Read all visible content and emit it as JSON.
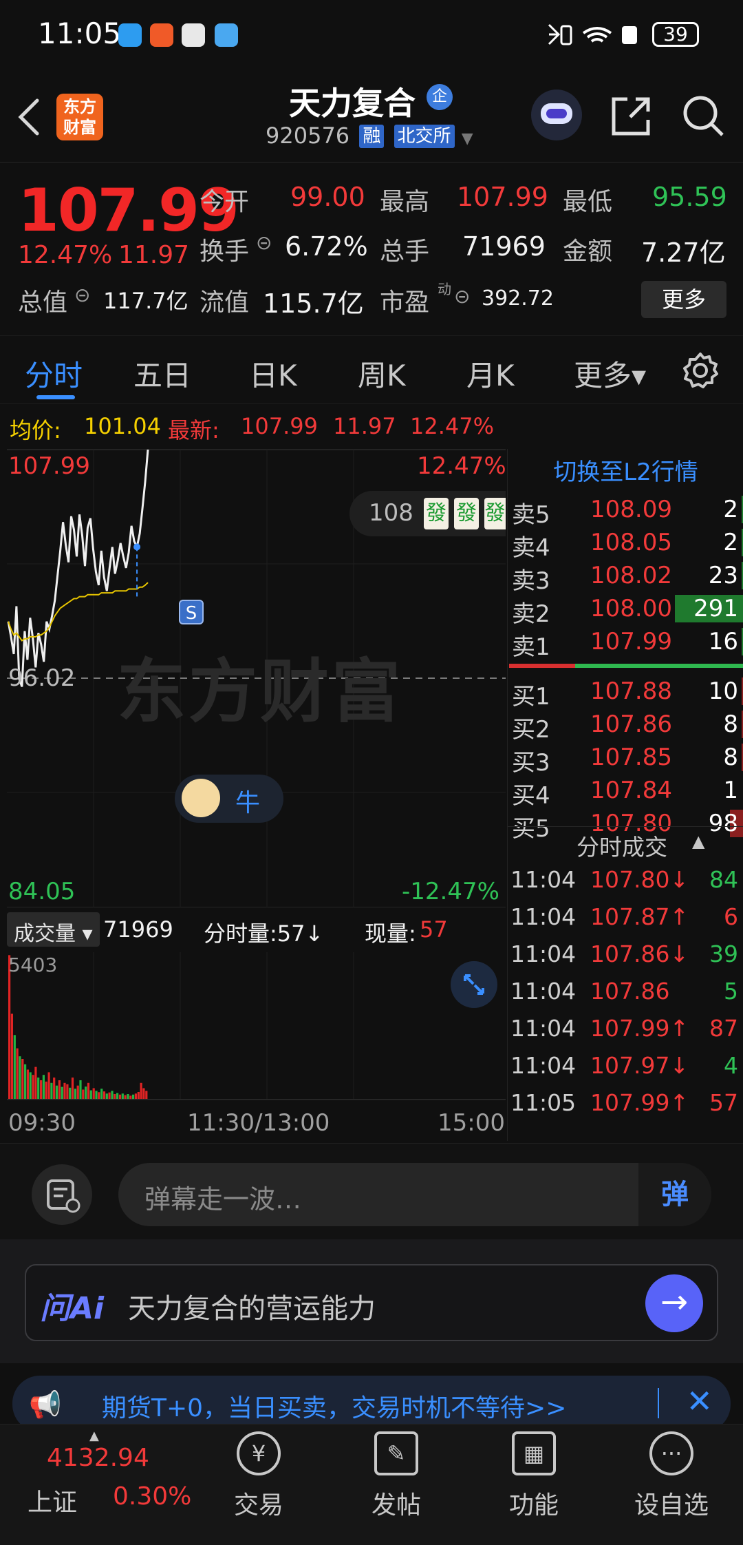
{
  "status_bar": {
    "time": "11:05",
    "battery": "39"
  },
  "header": {
    "logo_text": "东方财富",
    "stock_name": "天力复合",
    "corp_badge": "企",
    "stock_code": "920576",
    "tag_margin": "融",
    "tag_exchange": "北交所",
    "icons": [
      "back-icon",
      "robot-avatar-icon",
      "share-icon",
      "search-icon"
    ]
  },
  "quote": {
    "price": "107.99",
    "change_pct": "12.47%",
    "change_amt": "11.97",
    "open_label": "今开",
    "open": "99.00",
    "high_label": "最高",
    "high": "107.99",
    "low_label": "最低",
    "low": "95.59",
    "turnover_label": "换手",
    "turnover": "6.72%",
    "volume_label": "总手",
    "volume": "71969",
    "amount_label": "金额",
    "amount": "7.27亿",
    "mktcap_label": "总值",
    "mktcap": "117.7亿",
    "float_label": "流值",
    "float_cap": "115.7亿",
    "pe_label": "市盈",
    "pe_sup": "动",
    "pe": "392.72",
    "more_button": "更多"
  },
  "tabs": [
    {
      "label": "分时",
      "active": true
    },
    {
      "label": "五日"
    },
    {
      "label": "日K"
    },
    {
      "label": "周K"
    },
    {
      "label": "月K"
    },
    {
      "label": "更多▾"
    }
  ],
  "infoline": {
    "avg_label": "均价:",
    "avg": "101.04",
    "latest_label": "最新:",
    "latest": "107.99",
    "latest_chg": "11.97",
    "latest_pct": "12.47%"
  },
  "chart_labels": {
    "y_top": "107.99",
    "y_mid": "96.02",
    "y_bot": "84.05",
    "pct_top": "12.47%",
    "pct_bot": "-12.47%",
    "watermark": "东方财富",
    "bubble_price": "108",
    "bubble_tile": "發",
    "signal": "S",
    "niu": "牛"
  },
  "chart_data": {
    "type": "line",
    "title": "",
    "ylim": [
      84.05,
      107.99
    ],
    "series": [
      {
        "name": "",
        "values": [
          99.0,
          98.2,
          97.3,
          99.8,
          96.0,
          95.59,
          98.5,
          97.0,
          99.2,
          98.1,
          96.6,
          98.4,
          97.8,
          96.9,
          99.0,
          98.6,
          99.3,
          100.1,
          101.4,
          102.7,
          104.2,
          103.0,
          102.1,
          104.5,
          103.8,
          102.4,
          104.6,
          103.5,
          101.9,
          103.9,
          104.4,
          102.8,
          101.6,
          100.9,
          102.7,
          101.3,
          100.6,
          101.8,
          102.9,
          101.5,
          102.2,
          103.1,
          102.4,
          101.8,
          102.6,
          104.0,
          103.2,
          102.9,
          103.6,
          104.9,
          106.3,
          107.99
        ]
      },
      {
        "name": "",
        "values": [
          99.0,
          98.6,
          98.3,
          98.4,
          98.2,
          98.0,
          98.1,
          98.1,
          98.2,
          98.2,
          98.2,
          98.3,
          98.3,
          98.4,
          98.5,
          98.7,
          99.0,
          99.3,
          99.5,
          99.7,
          99.8,
          99.9,
          100.0,
          100.1,
          100.2,
          100.2,
          100.3,
          100.3,
          100.3,
          100.4,
          100.4,
          100.4,
          100.4,
          100.4,
          100.5,
          100.5,
          100.5,
          100.5,
          100.5,
          100.6,
          100.6,
          100.6,
          100.6,
          100.6,
          100.7,
          100.7,
          100.7,
          100.7,
          100.8,
          100.8,
          100.9,
          101.04
        ]
      }
    ],
    "volume": {
      "max": "5403",
      "values": [
        5403,
        3200,
        2400,
        1900,
        1600,
        1500,
        1300,
        1100,
        1000,
        900,
        1200,
        800,
        700,
        900,
        650,
        1000,
        600,
        800,
        500,
        700,
        450,
        600,
        550,
        420,
        800,
        380,
        500,
        700,
        350,
        460,
        600,
        320,
        400,
        300,
        250,
        380,
        280,
        200,
        240,
        300,
        180,
        220,
        160,
        200,
        140,
        180,
        120,
        160,
        200,
        260,
        600,
        400,
        300
      ],
      "colors": [
        "r",
        "r",
        "g",
        "r",
        "g",
        "r",
        "g",
        "r",
        "g",
        "r",
        "r",
        "g",
        "r",
        "g",
        "r",
        "r",
        "g",
        "r",
        "g",
        "r",
        "g",
        "r",
        "r",
        "g",
        "r",
        "g",
        "r",
        "g",
        "r",
        "g",
        "r",
        "g",
        "r",
        "g",
        "r",
        "g",
        "r",
        "g",
        "r",
        "g",
        "r",
        "g",
        "r",
        "g",
        "r",
        "g",
        "r",
        "g",
        "r",
        "r",
        "r",
        "r",
        "r"
      ]
    },
    "x_ticks": [
      "09:30",
      "11:30/13:00",
      "15:00"
    ]
  },
  "volume_head": {
    "selector": "成交量 ▾",
    "total": "71969",
    "tick_label": "分时量:57↓",
    "now_label": "现量:",
    "now": "57"
  },
  "orderbook": {
    "title": "切换至L2行情",
    "asks": [
      {
        "label": "卖5",
        "price": "108.09",
        "vol": "2",
        "bar": 0.01
      },
      {
        "label": "卖4",
        "price": "108.05",
        "vol": "2",
        "bar": 0.01
      },
      {
        "label": "卖3",
        "price": "108.02",
        "vol": "23",
        "bar": 0.03
      },
      {
        "label": "卖2",
        "price": "108.00",
        "vol": "291",
        "bar": 1.0
      },
      {
        "label": "卖1",
        "price": "107.99",
        "vol": "16",
        "bar": 0.02
      }
    ],
    "bids": [
      {
        "label": "买1",
        "price": "107.88",
        "vol": "10",
        "bar": 0.02
      },
      {
        "label": "买2",
        "price": "107.86",
        "vol": "8",
        "bar": 0.01
      },
      {
        "label": "买3",
        "price": "107.85",
        "vol": "8",
        "bar": 0.01
      },
      {
        "label": "买4",
        "price": "107.84",
        "vol": "1",
        "bar": 0.0
      },
      {
        "label": "买5",
        "price": "107.80",
        "vol": "98",
        "bar": 0.2
      }
    ],
    "trades_title": "分时成交",
    "trades": [
      {
        "time": "11:04",
        "price": "107.80↓",
        "vol": "84",
        "color": "#2fc256"
      },
      {
        "time": "11:04",
        "price": "107.87↑",
        "vol": "6",
        "color": "#f23a3a"
      },
      {
        "time": "11:04",
        "price": "107.86↓",
        "vol": "39",
        "color": "#2fc256"
      },
      {
        "time": "11:04",
        "price": "107.86",
        "vol": "5",
        "color": "#2fc256"
      },
      {
        "time": "11:04",
        "price": "107.99↑",
        "vol": "87",
        "color": "#f23a3a"
      },
      {
        "time": "11:04",
        "price": "107.97↓",
        "vol": "4",
        "color": "#2fc256"
      },
      {
        "time": "11:05",
        "price": "107.99↑",
        "vol": "57",
        "color": "#f23a3a"
      }
    ]
  },
  "danmu": {
    "placeholder": "弹幕走一波…",
    "button": "弹"
  },
  "ai": {
    "logo": "问Ai",
    "prompt": "天力复合的营运能力"
  },
  "notice": {
    "text": "期货T+0，当日买卖，交易时机不等待>>"
  },
  "bottom_nav": {
    "index_value": "4132.94",
    "index_name": "上证",
    "index_pct": "0.30%",
    "items": [
      {
        "label": "交易",
        "icon": "¥"
      },
      {
        "label": "发帖",
        "icon": "✎"
      },
      {
        "label": "功能",
        "icon": "▦"
      },
      {
        "label": "设自选",
        "icon": "···"
      }
    ]
  }
}
